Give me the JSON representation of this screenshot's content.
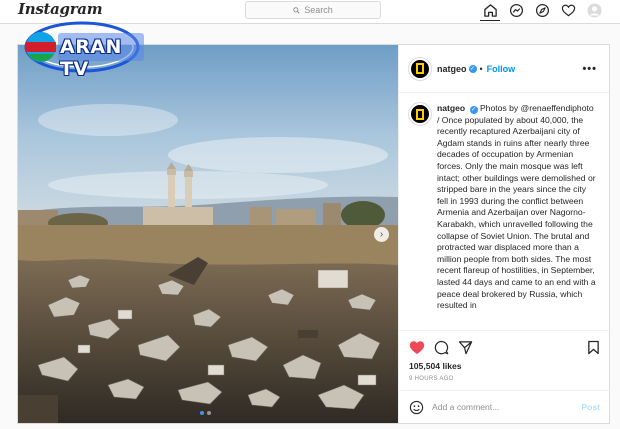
{
  "topbar": {
    "logo": "Instagram",
    "search_placeholder": "Search"
  },
  "watermark": {
    "text": "ARAN TV"
  },
  "post": {
    "username": "natgeo",
    "follow_label": "Follow",
    "more_label": "•••",
    "caption": "Photos by @renaeffendiphoto / Once populated by about 40,000, the recently recaptured Azerbaijani city of Agdam stands in ruins after nearly three decades of occupation by Armenian forces. Only the main mosque was left intact; other buildings were demolished or stripped bare in the years since the city fell in 1993 during the conflict between Armenia and Azerbaijan over Nagorno-Karabakh, which unravelled following the collapse of Soviet Union. The brutal and protracted war displaced more than a million people from both sides. The most recent flareup of hostilities, in September, lasted 44 days and came to an end with a peace deal brokered by Russia, which resulted in",
    "likes": "105,504 likes",
    "time": "9 HOURS AGO",
    "comment_placeholder": "Add a comment...",
    "post_label": "Post",
    "like_color": "#ed4956"
  }
}
